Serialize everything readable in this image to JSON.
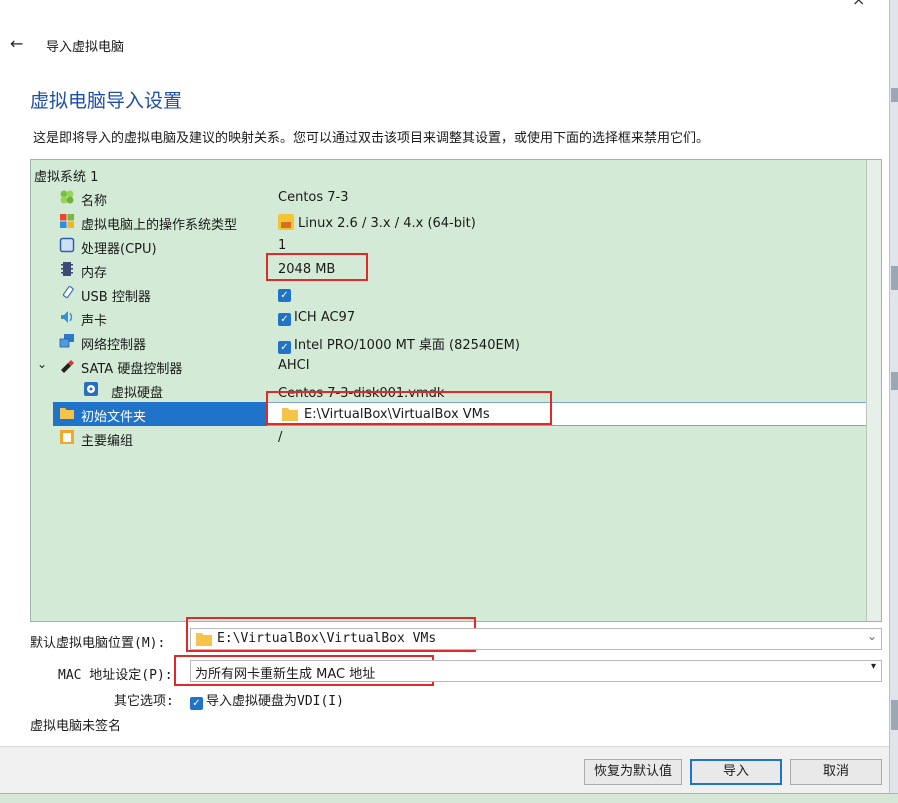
{
  "window": {
    "back_label": "←",
    "title": "导入虚拟电脑",
    "close_glyph": "×"
  },
  "page": {
    "heading": "虚拟电脑导入设置",
    "description": "这是即将导入的虚拟电脑及建议的映射关系。您可以通过双击该项目来调整其设置，或使用下面的选择框来禁用它们。"
  },
  "tree": {
    "system_label": "虚拟系统 1",
    "rows": [
      {
        "label": "名称",
        "value": "Centos 7-3",
        "icon": "name-icon"
      },
      {
        "label": "虚拟电脑上的操作系统类型",
        "value": "Linux 2.6 / 3.x / 4.x (64-bit)",
        "icon": "os-type-icon"
      },
      {
        "label": "处理器(CPU)",
        "value": "1",
        "icon": "cpu-icon"
      },
      {
        "label": "内存",
        "value": "2048 MB",
        "icon": "memory-icon"
      },
      {
        "label": "USB 控制器",
        "value": "",
        "icon": "usb-icon",
        "checked": true
      },
      {
        "label": "声卡",
        "value": "ICH AC97",
        "icon": "audio-icon",
        "checked": true
      },
      {
        "label": "网络控制器",
        "value": "Intel PRO/1000 MT 桌面 (82540EM)",
        "icon": "network-icon",
        "checked": true
      },
      {
        "label": "SATA 硬盘控制器",
        "value": "AHCI",
        "icon": "sata-icon"
      },
      {
        "label": "虚拟硬盘",
        "value": "Centos 7-3-disk001.vmdk",
        "icon": "disk-icon"
      },
      {
        "label": "初始文件夹",
        "value": "E:\\VirtualBox\\VirtualBox VMs",
        "icon": "folder-icon"
      },
      {
        "label": "主要编组",
        "value": "/",
        "icon": "group-icon"
      }
    ]
  },
  "form": {
    "default_location_label": "默认虚拟电脑位置(M):",
    "default_location_value": "E:\\VirtualBox\\VirtualBox VMs",
    "mac_label": "MAC 地址设定(P):",
    "mac_value": "为所有网卡重新生成 MAC 地址",
    "other_label": "其它选项:",
    "other_value": "导入虚拟硬盘为VDI(I)",
    "unsigned": "虚拟电脑未签名"
  },
  "buttons": {
    "restore": "恢复为默认值",
    "import": "导入",
    "cancel": "取消"
  },
  "colors": {
    "heading": "#1e4fa8",
    "tree_bg": "#d3ebd6",
    "selection": "#1f74c9",
    "highlight_box": "#e02a2a"
  }
}
